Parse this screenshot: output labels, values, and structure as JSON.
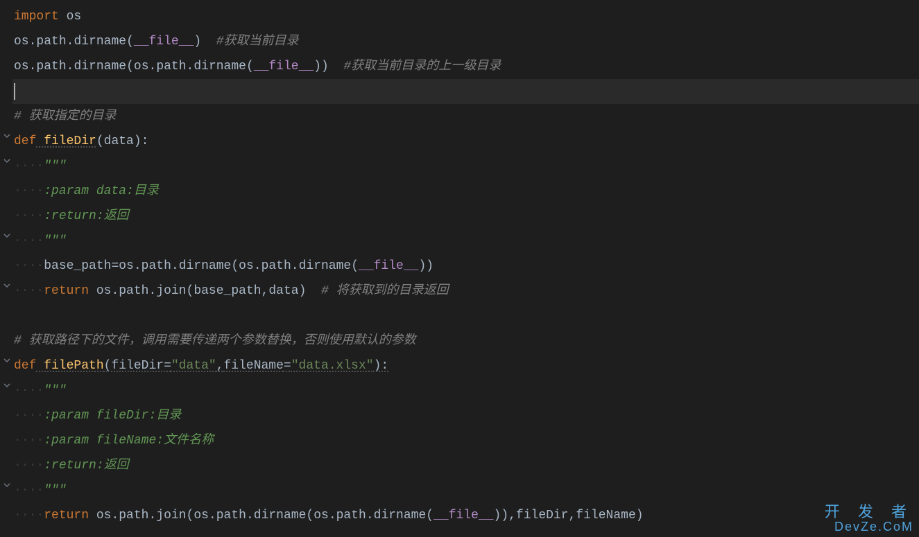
{
  "code": {
    "line1_import": "import",
    "line1_os": " os",
    "line2": "os.path.dirname(__file__)  ",
    "line2_comment": "#获取当前目录",
    "line3": "os.path.dirname(os.path.dirname(__file__))  ",
    "line3_comment": "#获取当前目录的上一级目录",
    "line5_comment": "# 获取指定的目录",
    "line6_def": "def",
    "line6_name": " fileDir",
    "line6_params": "(data):",
    "indent4": "····",
    "triple_quote": "\"\"\"",
    "line8_doc": ":param data:目录",
    "line9_doc": ":return:返回",
    "line11_code": "base_path=os.path.dirname(os.path.dirname(__file__))",
    "line12_return": "return",
    "line12_code": " os.path.join(base_path,data)  ",
    "line12_comment": "# 将获取到的目录返回",
    "line14_comment": "# 获取路径下的文件，调用需要传递两个参数替换，否则使用默认的参数",
    "line15_def": "def",
    "line15_name": " filePath",
    "line15_params_a": "(fileDir=",
    "line15_str1": "\"data\"",
    "line15_params_b": ",fileName=",
    "line15_str2": "\"data.xlsx\"",
    "line15_params_c": "):",
    "line17_doc": ":param fileDir:目录",
    "line18_doc": ":param fileName:文件名称",
    "line19_doc": ":return:返回",
    "line21_return": "return",
    "line21_code": " os.path.join(os.path.dirname(os.path.dirname(__file__)),fileDir,fileName)"
  },
  "watermark": {
    "line1": "开 发 者",
    "line2": "DevZe.CoM"
  }
}
